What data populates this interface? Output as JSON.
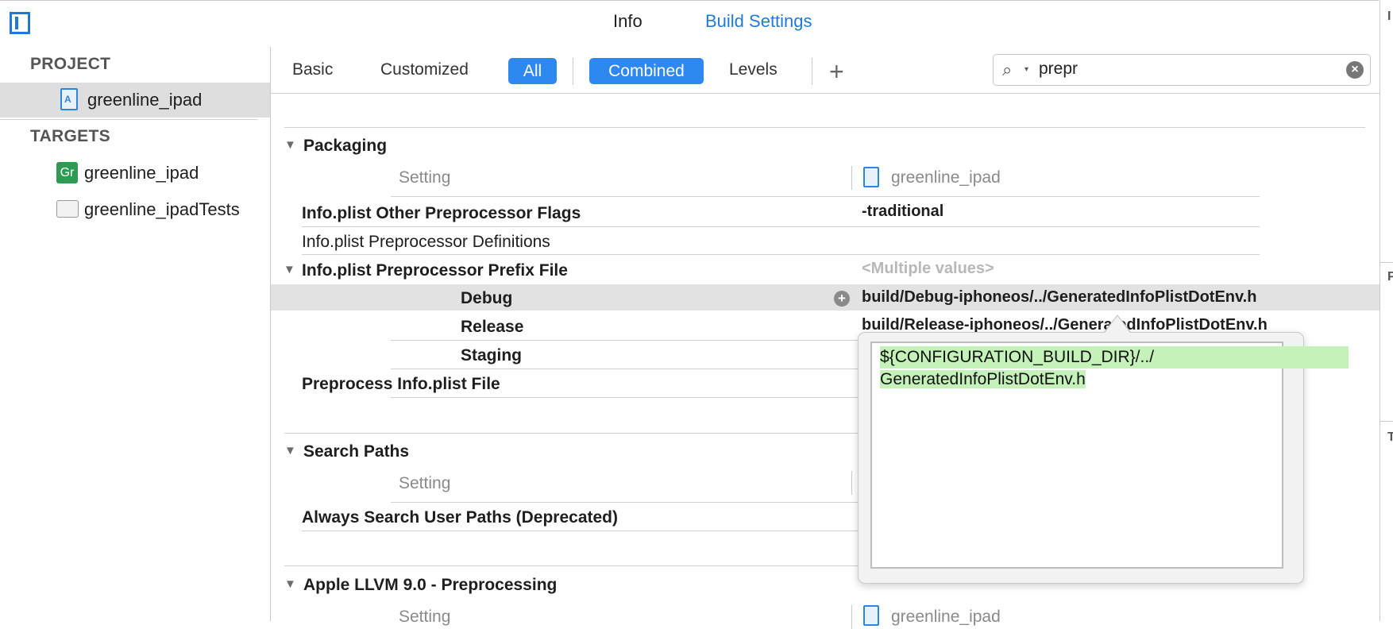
{
  "colors": {
    "accent": "#2f87f0",
    "link": "#1f7ad8",
    "highlight": "#c5f2b8",
    "selected_row": "#e2e2e2"
  },
  "top_tabs": {
    "info": "Info",
    "build_settings": "Build Settings"
  },
  "right_strip_letters": [
    "I",
    "P",
    "T"
  ],
  "navigator": {
    "project_heading": "PROJECT",
    "project_item": "greenline_ipad",
    "targets_heading": "TARGETS",
    "targets": [
      {
        "label": "greenline_ipad",
        "icon": "gr-app-icon",
        "icon_text": "Gr"
      },
      {
        "label": "greenline_ipadTests",
        "icon": "folder-icon"
      }
    ]
  },
  "filter_bar": {
    "basic": "Basic",
    "customized": "Customized",
    "all": "All",
    "combined": "Combined",
    "levels": "Levels",
    "add": "+",
    "search_value": "prepr",
    "search_icon": "magnifier-icon",
    "clear_icon": "clear-icon"
  },
  "sections": {
    "packaging": {
      "title": "Packaging",
      "column_setting": "Setting",
      "column_target": "greenline_ipad",
      "rows": {
        "other_flags": {
          "label": "Info.plist Other Preprocessor Flags",
          "value": "-traditional"
        },
        "definitions": {
          "label": "Info.plist Preprocessor Definitions",
          "value": ""
        },
        "prefix_file": {
          "label": "Info.plist Preprocessor Prefix File",
          "value": "<Multiple values>"
        },
        "debug": {
          "label": "Debug",
          "value": "build/Debug-iphoneos/../GeneratedInfoPlistDotEnv.h"
        },
        "release": {
          "label": "Release",
          "value": "build/Release-iphoneos/../GeneratedInfoPlistDotEnv.h"
        },
        "staging": {
          "label": "Staging",
          "value": ""
        },
        "preprocess": {
          "label": "Preprocess Info.plist File",
          "value": ""
        }
      }
    },
    "search_paths": {
      "title": "Search Paths",
      "column_setting": "Setting",
      "rows": {
        "always_search": {
          "label": "Always Search User Paths (Deprecated)",
          "value": ""
        }
      }
    },
    "llvm": {
      "title": "Apple LLVM 9.0 - Preprocessing",
      "column_setting": "Setting",
      "column_target": "greenline_ipad"
    }
  },
  "popover": {
    "line1": "${CONFIGURATION_BUILD_DIR}/../",
    "line2": "GeneratedInfoPlistDotEnv.h"
  }
}
